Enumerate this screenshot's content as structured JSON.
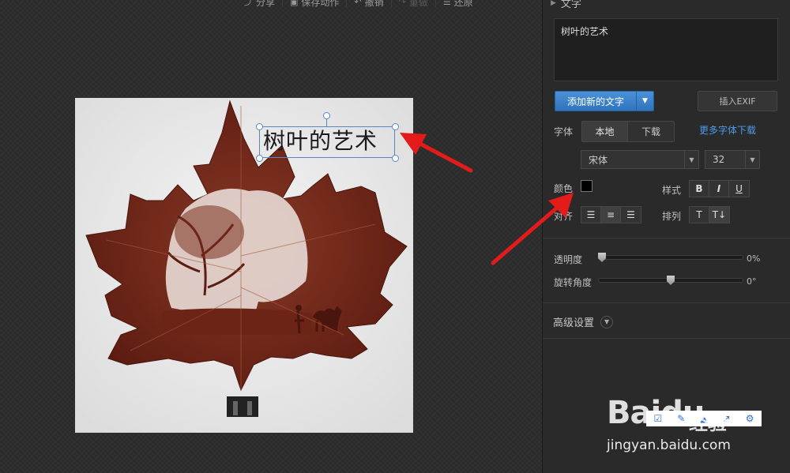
{
  "toolbar": {
    "share": "分享",
    "save_action": "保存动作",
    "undo": "撤销",
    "redo": "重做",
    "restore": "还原"
  },
  "photo": {
    "overlay_text": "树叶的艺术"
  },
  "panel": {
    "section_title": "文字",
    "text_value": "树叶的艺术",
    "add_text_label": "添加新的文字",
    "insert_exif_label": "插入EXIF",
    "font_label": "字体",
    "font_source_tabs": [
      "本地",
      "下载"
    ],
    "more_fonts": "更多字体下载",
    "font_family": "宋体",
    "font_size": "32",
    "color_label": "颜色",
    "color_value": "#000000",
    "style_label": "样式",
    "style_buttons": [
      "B",
      "I",
      "U"
    ],
    "align_label": "对齐",
    "arrange_label": "排列",
    "opacity_label": "透明度",
    "opacity_value": "0%",
    "opacity_fraction": 0.0,
    "rotation_label": "旋转角度",
    "rotation_value": "0°",
    "rotation_fraction": 0.5,
    "advanced_label": "高级设置"
  },
  "watermark": {
    "brand": "Baidu",
    "brand_cn": "经验",
    "url": "jingyan.baidu.com"
  },
  "colors": {
    "accent": "#3d86d0",
    "link": "#4d9ae8",
    "annotation_arrow": "#e31b1b",
    "selection": "#5b86c4"
  }
}
